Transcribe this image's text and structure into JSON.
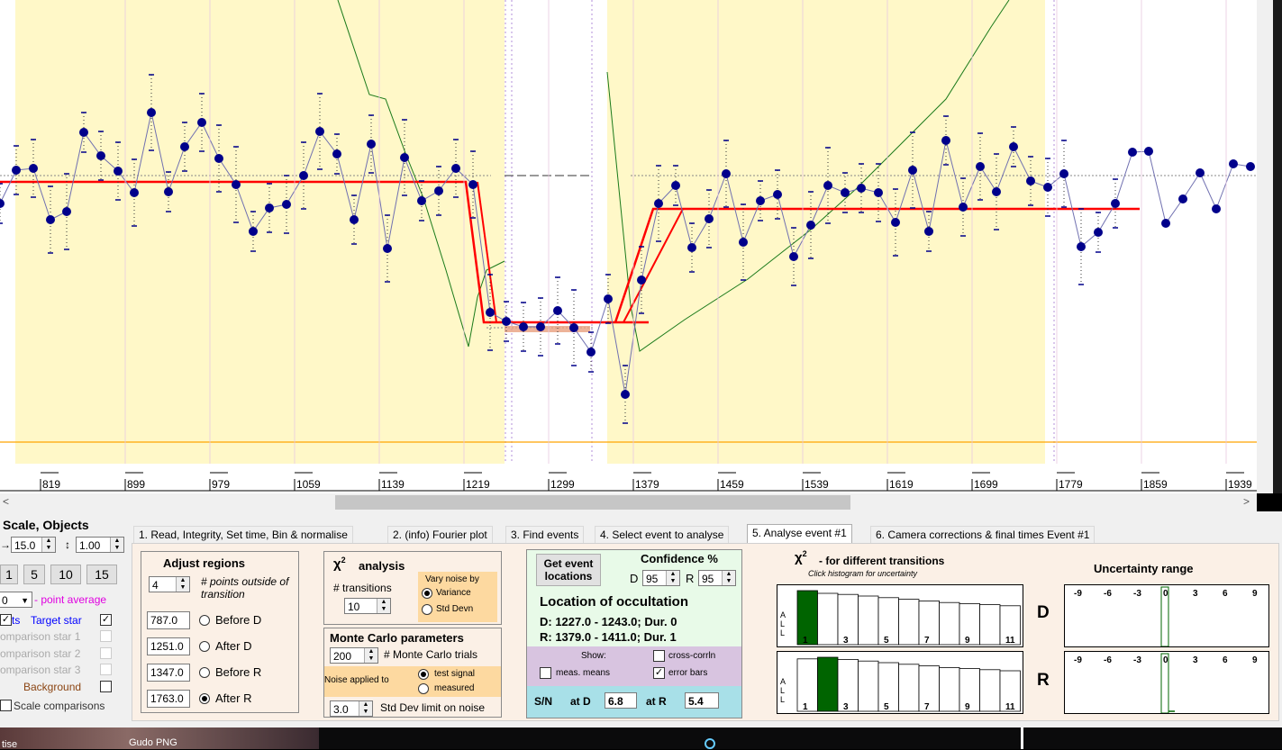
{
  "chart": {
    "x_ticks": [
      "819",
      "899",
      "979",
      "1059",
      "1139",
      "1219",
      "1299",
      "1379",
      "1459",
      "1539",
      "1619",
      "1699",
      "1779",
      "1859",
      "1939"
    ],
    "line_colors": {
      "data": "#00008b",
      "model": "#ff0000",
      "green": "#1a7a1a",
      "baseline": "#ffa500",
      "highlight": "#fff8c8"
    }
  },
  "scroll": {
    "left_arrow": "<",
    "right_arrow": ">"
  },
  "left_panel": {
    "title": "Scale, Objects",
    "x_scale": "15.0",
    "y_scale": "1.00",
    "scale_buttons": [
      "1",
      "5",
      "10",
      "15"
    ],
    "avg_value": "0",
    "avg_label": "- point average",
    "target_prefix": "ts",
    "target_label": "Target star",
    "comp1": "omparison star 1",
    "comp2": "omparison star 2",
    "comp3": "omparison star 3",
    "background": "Background",
    "scale_comp": "Scale comparisons"
  },
  "tabs": [
    "1. Read, Integrity, Set time, Bin & normalise",
    "2. (info) Fourier plot",
    "3. Find events",
    "4. Select event to analyse",
    "5. Analyse event #1",
    "6. Camera corrections & final times Event #1"
  ],
  "adjust": {
    "title": "Adjust regions",
    "points": "4",
    "points_label": "# points outside of transition",
    "values": [
      "787.0",
      "1251.0",
      "1347.0",
      "1763.0"
    ],
    "labels": [
      "Before D",
      "After D",
      "Before R",
      "After R"
    ],
    "selected": 3
  },
  "chi2": {
    "title": "analysis",
    "transitions_label": "# transitions",
    "transitions": "10",
    "vary_label": "Vary noise by",
    "variance": "Variance",
    "stddevn": "Std Devn"
  },
  "monte": {
    "title": "Monte Carlo parameters",
    "trials": "200",
    "trials_label": "# Monte Carlo trials",
    "noise_label": "Noise applied to",
    "test_signal": "test signal",
    "measured": "measured",
    "limit": "3.0",
    "limit_label": "Std Dev limit on noise"
  },
  "location": {
    "get_btn": "Get event locations",
    "confidence": "Confidence %",
    "d_label": "D",
    "d_val": "95",
    "r_label": "R",
    "r_val": "95",
    "title": "Location of occultation",
    "d_line": "D: 1227.0 - 1243.0; Dur. 0",
    "r_line": "R: 1379.0 - 1411.0; Dur. 1",
    "show": "Show:",
    "cross": "cross-corrln",
    "means": "meas. means",
    "errbars": "error bars",
    "sn": "S/N",
    "at_d": "at D",
    "sn_d": "6.8",
    "at_r": "at R",
    "sn_r": "5.4"
  },
  "hist": {
    "title": "- for different transitions",
    "subtitle": "Click histogram for uncertainty",
    "all": [
      "A",
      "L",
      "L"
    ],
    "d_label": "D",
    "r_label": "R",
    "x_labels": [
      "1",
      "3",
      "5",
      "7",
      "9",
      "11"
    ],
    "d_values": [
      1.0,
      0.95,
      0.93,
      0.9,
      0.87,
      0.84,
      0.81,
      0.78,
      0.76,
      0.74,
      0.72
    ],
    "r_values": [
      0.97,
      1.0,
      0.96,
      0.93,
      0.9,
      0.87,
      0.84,
      0.81,
      0.79,
      0.77,
      0.75
    ]
  },
  "uncertainty": {
    "title": "Uncertainty range",
    "ticks": [
      "-9",
      "-6",
      "-3",
      "0",
      "3",
      "6",
      "9"
    ]
  },
  "taskbar": {
    "item1": "tise",
    "item2": "Gudo PNG"
  }
}
